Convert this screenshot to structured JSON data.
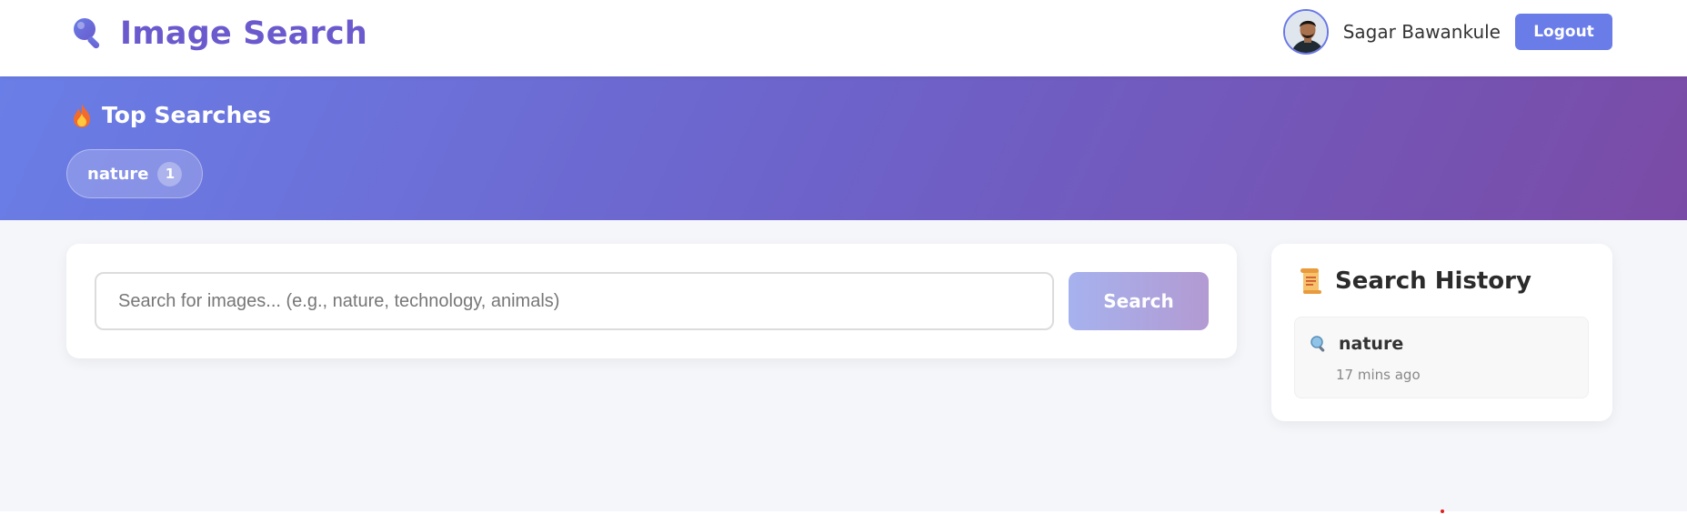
{
  "header": {
    "brand_icon": "magnifier-icon",
    "brand_title": "Image Search",
    "brand_color": "#6a5acd",
    "user": {
      "name": "Sagar Bawankule",
      "avatar": "avatar-photo"
    },
    "logout_label": "Logout",
    "logout_color": "#6a7ce8"
  },
  "top_searches": {
    "icon": "fire-icon",
    "title": "Top Searches",
    "items": [
      {
        "label": "nature",
        "count": "1"
      }
    ],
    "gradient_colors": [
      "#6a7ee7",
      "#6d62c9",
      "#7a4ba6"
    ]
  },
  "search": {
    "placeholder": "Search for images... (e.g., nature, technology, animals)",
    "value": "",
    "button_label": "Search"
  },
  "history": {
    "icon": "scroll-icon",
    "title": "Search History",
    "items": [
      {
        "icon": "search-icon",
        "query": "nature",
        "time": "17 mins ago"
      }
    ]
  }
}
